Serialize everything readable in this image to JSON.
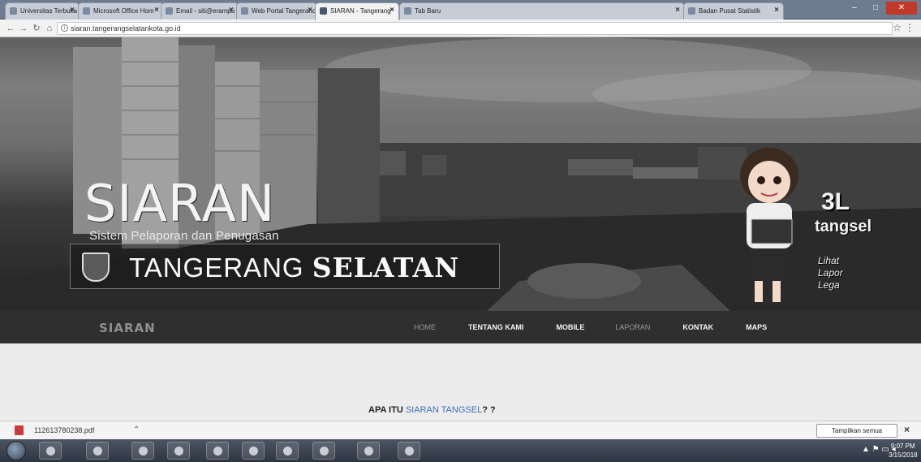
{
  "browser": {
    "tabs": [
      {
        "label": "Universitas Terbuka",
        "active": false
      },
      {
        "label": "Microsoft Office Hom",
        "active": false
      },
      {
        "label": "Email - siti@erampu",
        "active": false
      },
      {
        "label": "Web Portal Tangeranc",
        "active": false
      },
      {
        "label": "SIARAN - Tangerang",
        "active": true
      },
      {
        "label": "Tab Baru",
        "active": false
      },
      {
        "label": "Badan Pusat Statistik",
        "active": false
      }
    ],
    "url": "siaran.tangerangselatankota.go.id"
  },
  "hero": {
    "logo_title": "SIARAN",
    "logo_subtitle": "Sistem Pelaporan dan Penugasan",
    "city_light": "TANGERANG ",
    "city_bold": "SELATAN",
    "badge_3l": "3L",
    "badge_tangsel": "tangsel",
    "badge_items": [
      "Lihat",
      "Lapor",
      "Lega"
    ]
  },
  "site_nav": {
    "brand": "SIARAN",
    "links": [
      {
        "label": "HOME",
        "dim": true
      },
      {
        "label": "TENTANG KAMI",
        "dim": false
      },
      {
        "label": "MOBILE",
        "dim": false
      },
      {
        "label": "LAPORAN",
        "dim": true
      },
      {
        "label": "KONTAK",
        "dim": false
      },
      {
        "label": "MAPS",
        "dim": false
      }
    ]
  },
  "content": {
    "apa_prefix": "APA ITU ",
    "apa_highlight": "SIARAN TANGSEL",
    "apa_suffix": "? ?"
  },
  "download_shelf": {
    "file_name": "112613780238.pdf",
    "show_all": "Tampilkan semua"
  },
  "taskbar": {
    "time": "9:07 PM",
    "date": "3/15/2018"
  }
}
